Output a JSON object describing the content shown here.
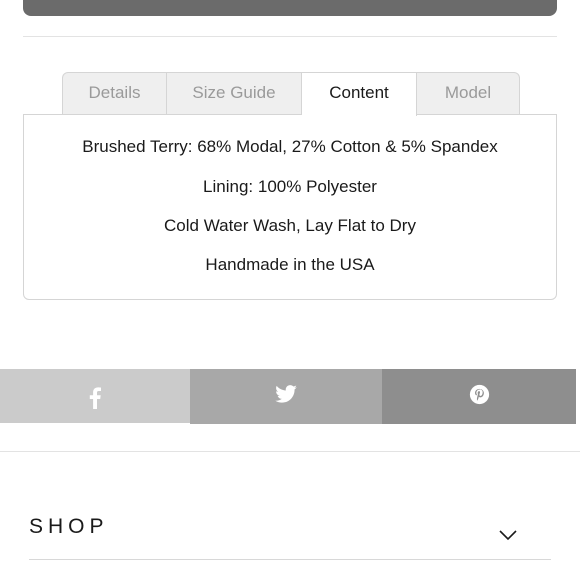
{
  "tabs": [
    {
      "label": "Details",
      "active": false
    },
    {
      "label": "Size Guide",
      "active": false
    },
    {
      "label": "Content",
      "active": true
    },
    {
      "label": "Model",
      "active": false
    }
  ],
  "content": {
    "line1": "Brushed Terry:  68% Modal, 27% Cotton & 5% Spandex",
    "line2": "Lining: 100% Polyester",
    "line3": "Cold Water Wash, Lay Flat to Dry",
    "line4": "Handmade in the USA"
  },
  "share": {
    "icons": [
      "facebook-icon",
      "twitter-icon",
      "pinterest-icon"
    ],
    "colors": {
      "facebook": "#cbcbcb",
      "twitter": "#a8a8a8",
      "pinterest": "#8e8e8e"
    }
  },
  "footer": {
    "shop_label": "SHOP",
    "shop_icon": "chevron-down-icon"
  }
}
